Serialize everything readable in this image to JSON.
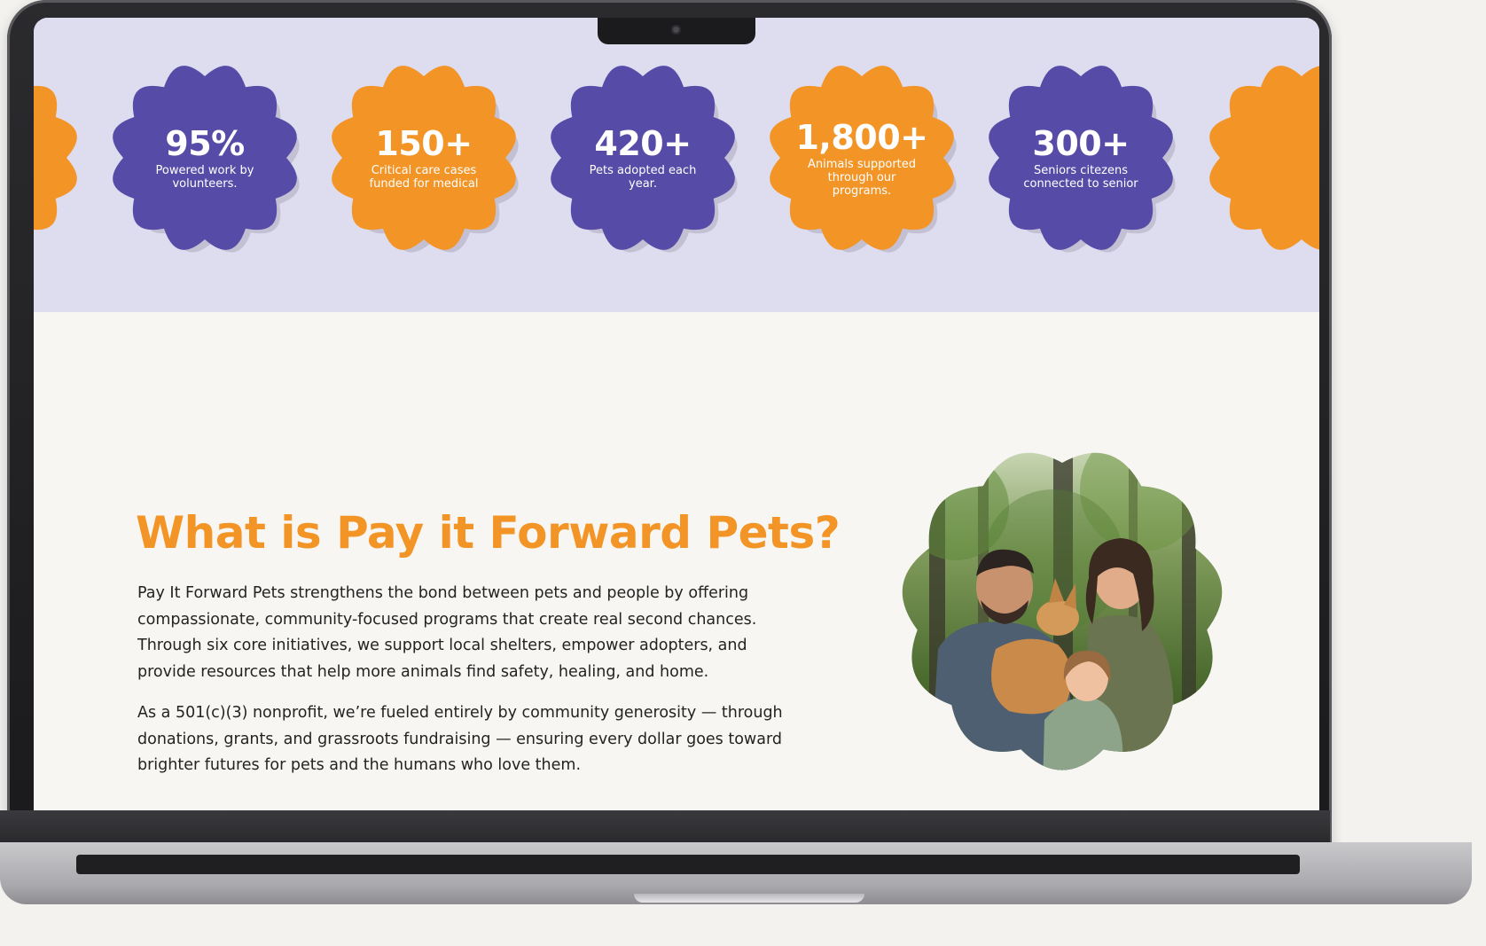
{
  "stats": [
    {
      "value": "95%",
      "caption": "Powered work by volunteers.",
      "color": "#574ba8"
    },
    {
      "value": "150+",
      "caption": "Critical care cases funded for medical",
      "color": "#f39426"
    },
    {
      "value": "420+",
      "caption": "Pets adopted each year.",
      "color": "#574ba8"
    },
    {
      "value": "1,800+",
      "caption": "Animals supported through our programs.",
      "color": "#f39426"
    },
    {
      "value": "300+",
      "caption": "Seniors citezens connected to senior",
      "color": "#574ba8"
    }
  ],
  "about": {
    "heading": "What is Pay it Forward Pets?",
    "paragraph_1": "Pay It Forward Pets strengthens the bond between pets and people by offering compassionate, community-focused programs that create real second chances. Through six core initiatives, we support local shelters, empower adopters, and provide resources that help more animals find safety, healing, and home.",
    "paragraph_2": "As a 501(c)(3) nonprofit, we’re fueled entirely by community generosity — through donations, grants, and grassroots fundraising — ensuring every dollar goes toward brighter futures for pets and the humans who love them."
  },
  "colors": {
    "orange": "#f39426",
    "purple": "#574ba8",
    "band_bg": "#dedcef",
    "page_bg": "#f7f6f2",
    "text": "#232323"
  }
}
